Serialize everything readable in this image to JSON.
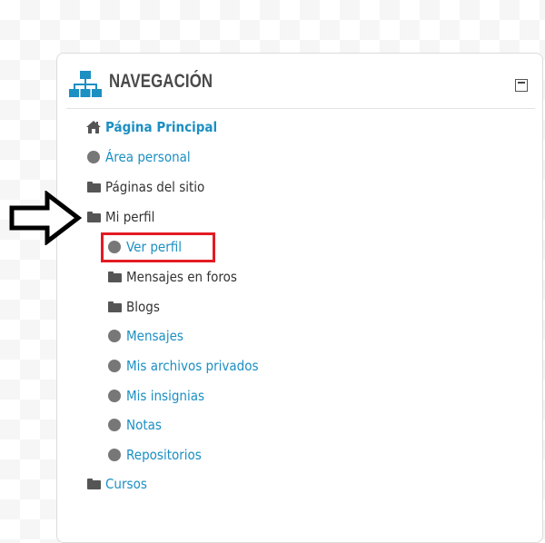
{
  "block": {
    "title": "NAVEGACIÓN"
  },
  "nav": {
    "home": "Página Principal",
    "area_personal": "Área personal",
    "paginas_sitio": "Páginas del sitio",
    "mi_perfil": "Mi perfil",
    "ver_perfil": "Ver perfil",
    "mensajes_foros": "Mensajes en foros",
    "blogs": "Blogs",
    "mensajes": "Mensajes",
    "archivos_privados": "Mis archivos privados",
    "insignias": "Mis insignias",
    "notas": "Notas",
    "repositorios": "Repositorios",
    "cursos": "Cursos"
  },
  "icons": {
    "header": "sitemap-icon",
    "collapse": "minimize-icon",
    "home": "home-icon",
    "leaf": "bullet-dot-icon",
    "branch": "folder-icon",
    "pointer": "arrow-right-icon"
  },
  "colors": {
    "link": "#1c8fc3",
    "header_icon": "#1c8fc3",
    "text": "#333333",
    "highlight": "#e31b23"
  }
}
